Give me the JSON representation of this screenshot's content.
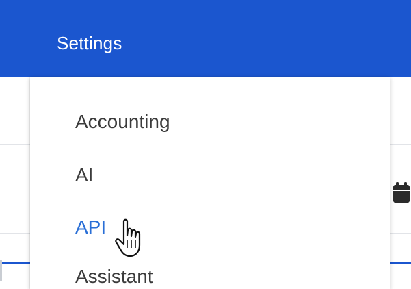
{
  "header": {
    "title": "Settings"
  },
  "menu": {
    "items": [
      {
        "label": "Accounting"
      },
      {
        "label": "AI"
      },
      {
        "label": "API"
      },
      {
        "label": "Assistant"
      }
    ],
    "active_item": "API"
  },
  "colors": {
    "header_bg": "#1b56cf",
    "active_item_text": "#2a6fd6",
    "item_text": "#3b3b3b"
  },
  "icons": {
    "calendar": "calendar-icon",
    "cursor": "hand-pointer-cursor-icon"
  }
}
